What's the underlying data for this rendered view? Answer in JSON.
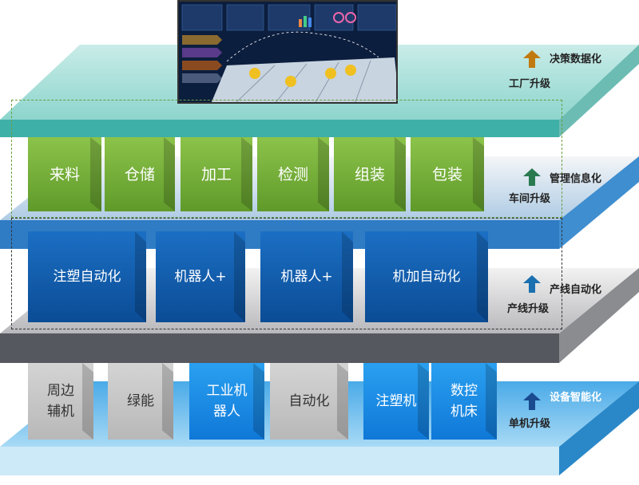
{
  "levels": [
    {
      "title": "决策数据化",
      "subtitle": "工厂升级",
      "arrow_color": "#c07a10"
    },
    {
      "title": "管理信息化",
      "subtitle": "车间升级",
      "arrow_color": "#2a7a50"
    },
    {
      "title": "产线自动化",
      "subtitle": "产线升级",
      "arrow_color": "#1a70b0"
    },
    {
      "title": "设备智能化",
      "subtitle": "单机升级",
      "arrow_color": "#1a4a90"
    }
  ],
  "workshop_boxes": [
    "来料",
    "仓储",
    "加工",
    "检测",
    "组装",
    "包装"
  ],
  "line_boxes": [
    "注塑自动化",
    "机器人+",
    "机器人+",
    "机加自动化"
  ],
  "device_boxes": [
    "周边辅机",
    "绿能",
    "工业机器人",
    "自动化",
    "注塑机",
    "数控机床"
  ],
  "colors": {
    "top_plate": "#7fcfc8",
    "green": "#7ab83a",
    "blue": "#0b5aa8",
    "gray": "#c8c8c8",
    "device_blue": "#1a8ae0"
  },
  "screen": {
    "icon": "factory-dashboard-image"
  }
}
